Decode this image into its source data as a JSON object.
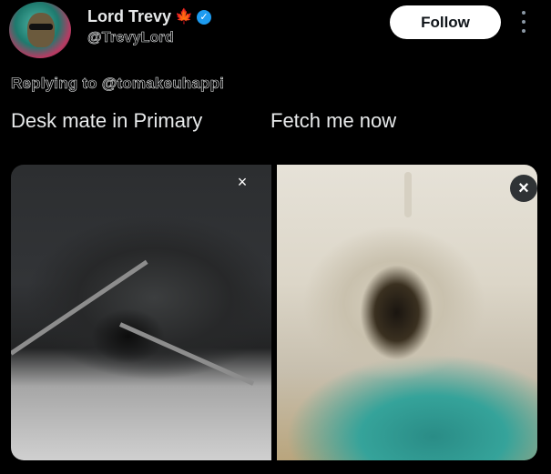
{
  "header": {
    "display_name": "Lord Trevy",
    "name_emoji": "maple-leaf-icon",
    "verified_icon": "verified-check-icon",
    "handle": "@TrevyLord",
    "follow_label": "Follow",
    "more_icon": "more-vertical-icon"
  },
  "reply": {
    "prefix": "Replying to ",
    "mention": "@tomakeuhappi"
  },
  "captions": {
    "left": "Desk mate in Primary",
    "right": "Fetch me now"
  },
  "media": {
    "close_glyph": "×",
    "images": [
      "drawstring-bag-black-photo",
      "drawstring-bag-cream-photo"
    ]
  },
  "colors": {
    "background": "#000000",
    "text": "#e7e9ea",
    "verified": "#1d9bf0",
    "maple": "#e0245e",
    "follow_bg": "#ffffff"
  }
}
